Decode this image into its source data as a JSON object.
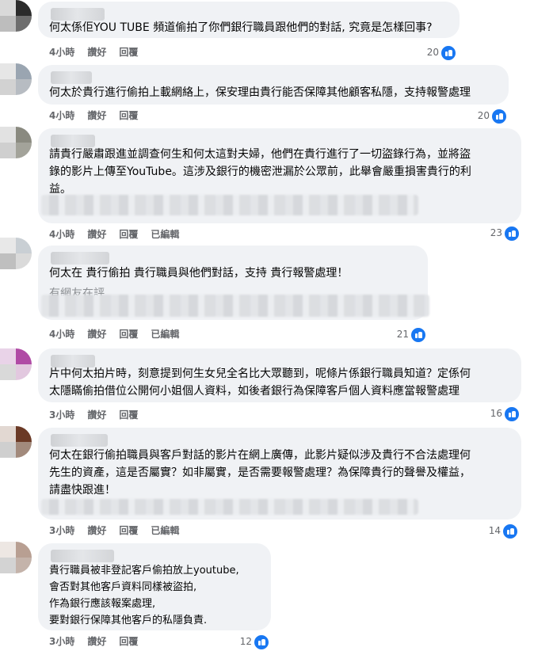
{
  "colors": {
    "like_blue": "#1877f2",
    "bubble_bg": "#f0f2f5",
    "meta_gray": "#65676b"
  },
  "comments": [
    {
      "text": "何太係佢YOU TUBE 頻道偷拍了你們銀行職員跟他們的對話, 究竟是怎樣回事?",
      "time": "4小時",
      "like": "讚好",
      "reply": "回覆",
      "edited": "",
      "reactions": "20"
    },
    {
      "text": "何太於貴行進行偷拍上載網絡上，保安理由貴行能否保障其他顧客私隱，支持報警處理",
      "time": "4小時",
      "like": "讚好",
      "reply": "回覆",
      "edited": "",
      "reactions": "20"
    },
    {
      "text": "請貴行嚴肅跟進並調查何生和何太這對夫婦，他們在貴行進行了一切盜錄行為，並將盜\n錄的影片上傳至YouTube。這涉及銀行的機密泄漏於公眾前，此舉會嚴重損害貴行的利\n益。",
      "time": "4小時",
      "like": "讚好",
      "reply": "回覆",
      "edited": "已編輯",
      "reactions": "23"
    },
    {
      "text": "何太在 貴行偷拍 貴行職員與他們對話，支持 貴行報警處理！",
      "text2": "有網友在評",
      "time": "4小時",
      "like": "讚好",
      "reply": "回覆",
      "edited": "已編輯",
      "reactions": "21"
    },
    {
      "text": "片中何太拍片時，刻意提到何生女兒全名比大眾聽到，呢條片係銀行職員知道？定係何\n太隱瞞偷拍借位公開何小姐個人資料，如後者銀行為保障客戶個人資料應當報警處理",
      "time": "3小時",
      "like": "讚好",
      "reply": "回覆",
      "edited": "",
      "reactions": "16"
    },
    {
      "text": "何太在銀行偷拍職員與客戶對話的影片在網上廣傳，此影片疑似涉及貴行不合法處理何\n先生的資產，這是否屬實？如非屬實，是否需要報警處理？為保障貴行的聲譽及權益，\n請盡快跟進！",
      "time": "3小時",
      "like": "讚好",
      "reply": "回覆",
      "edited": "已編輯",
      "reactions": "14"
    },
    {
      "text": "貴行職員被非登記客戶偷拍放上youtube,\n會否對其他客戶資料同樣被盜拍,\n作為銀行應該報案處理,\n要對銀行保障其他客戶的私隱負責.",
      "time": "3小時",
      "like": "讚好",
      "reply": "回覆",
      "edited": "",
      "reactions": "12"
    }
  ]
}
